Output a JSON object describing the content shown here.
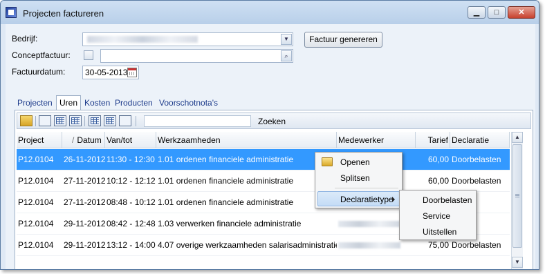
{
  "window": {
    "title": "Projecten factureren",
    "min_label": "▁",
    "max_label": "□",
    "close_label": "✕"
  },
  "form": {
    "bedrijf_label": "Bedrijf:",
    "concept_label": "Conceptfactuur:",
    "datum_label": "Factuurdatum:",
    "datum_value": "30-05-2013",
    "generate_button": "Factuur genereren"
  },
  "tabs": [
    "Projecten",
    "Uren",
    "Kosten",
    "Producten",
    "Voorschotnota's"
  ],
  "toolbar": {
    "search_label": "Zoeken"
  },
  "grid": {
    "columns": [
      "Project",
      "Datum",
      "Van/tot",
      "Werkzaamheden",
      "Medewerker",
      "Tarief",
      "Declaratie"
    ],
    "sort_marker": "/",
    "rows": [
      {
        "project": "P12.0104",
        "datum": "26-11-2012",
        "vantot": "11:30 - 12:30",
        "werk": "1.01 ordenen financiele administratie",
        "tarief": "60,00",
        "declaratie": "Doorbelasten"
      },
      {
        "project": "P12.0104",
        "datum": "27-11-2012",
        "vantot": "10:12 - 12:12",
        "werk": "1.01 ordenen financiele administratie",
        "tarief": "60,00",
        "declaratie": "Doorbelasten"
      },
      {
        "project": "P12.0104",
        "datum": "27-11-2012",
        "vantot": "08:48 - 10:12",
        "werk": "1.01 ordenen financiele administratie",
        "tarief": "",
        "declaratie": ""
      },
      {
        "project": "P12.0104",
        "datum": "29-11-2012",
        "vantot": "08:42 - 12:48",
        "werk": "1.03 verwerken financiele administratie",
        "tarief": "",
        "declaratie": ""
      },
      {
        "project": "P12.0104",
        "datum": "29-11-2012",
        "vantot": "13:12 - 14:00",
        "werk": "4.07 overige werkzaamheden salarisadministratie",
        "tarief": "75,00",
        "declaratie": "Doorbelasten"
      }
    ]
  },
  "context_menu": {
    "items": [
      "Openen",
      "Splitsen",
      "Declaratietype"
    ]
  },
  "submenu": {
    "items": [
      "Doorbelasten",
      "Service",
      "Uitstellen"
    ]
  },
  "colors": {
    "selection": "#3399ff",
    "tab_text": "#1c3a8a"
  }
}
